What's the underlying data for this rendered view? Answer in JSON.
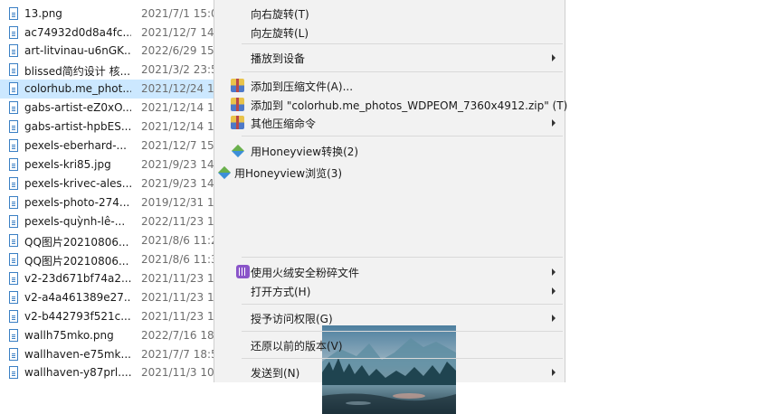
{
  "file_list": {
    "rows": [
      {
        "name": "13.png",
        "date": "2021/7/1 15:0"
      },
      {
        "name": "ac74932d0d8a4fc...",
        "date": "2021/12/7 14:"
      },
      {
        "name": "art-litvinau-u6nGK...",
        "date": "2022/6/29 15:"
      },
      {
        "name": "blissed简约设计 核...",
        "date": "2021/3/2 23:5"
      },
      {
        "name": "colorhub.me_phot...",
        "date": "2021/12/24 14",
        "selected": true
      },
      {
        "name": "gabs-artist-eZ0xO...",
        "date": "2021/12/14 14"
      },
      {
        "name": "gabs-artist-hpbES...",
        "date": "2021/12/14 14"
      },
      {
        "name": "pexels-eberhard-...",
        "date": "2021/12/7 15:"
      },
      {
        "name": "pexels-kri85.jpg",
        "date": "2021/9/23 14:"
      },
      {
        "name": "pexels-krivec-ales...",
        "date": "2021/9/23 14:"
      },
      {
        "name": "pexels-photo-274...",
        "date": "2019/12/31 10"
      },
      {
        "name": "pexels-quỳnh-lê-...",
        "date": "2022/11/23 10"
      },
      {
        "name": "QQ图片20210806...",
        "date": "2021/8/6 11:2"
      },
      {
        "name": "QQ图片20210806...",
        "date": "2021/8/6 11:3"
      },
      {
        "name": "v2-23d671bf74a2...",
        "date": "2021/11/23 10"
      },
      {
        "name": "v2-a4a461389e27...",
        "date": "2021/11/23 10"
      },
      {
        "name": "v2-b442793f521c...",
        "date": "2021/11/23 11"
      },
      {
        "name": "wallh75mko.png",
        "date": "2022/7/16 18:"
      },
      {
        "name": "wallhaven-e75mk...",
        "date": "2021/7/7 18:5"
      },
      {
        "name": "wallhaven-y87prl....",
        "date": "2021/11/3 10:"
      }
    ]
  },
  "context_menu": {
    "rotate_right": "向右旋转(T)",
    "rotate_left": "向左旋转(L)",
    "cast_to_device": "播放到设备",
    "add_to_archive": "添加到压缩文件(A)...",
    "add_to_zip": "添加到 \"colorhub.me_photos_WDPEOM_7360x4912.zip\" (T)",
    "other_compress": "其他压缩命令",
    "honeyview_convert": "用Honeyview转换(2)",
    "honeyview_browse": "用Honeyview浏览(3)",
    "shred": "使用火绒安全粉碎文件",
    "open_with": "打开方式(H)",
    "grant_access": "授予访问权限(G)",
    "restore_versions": "还原以前的版本(V)",
    "send_to": "发送到(N)"
  },
  "colors": {
    "menu_bg": "#f2f2f2",
    "selected_row": "#cce8ff",
    "date_text": "#6d6d6d"
  }
}
